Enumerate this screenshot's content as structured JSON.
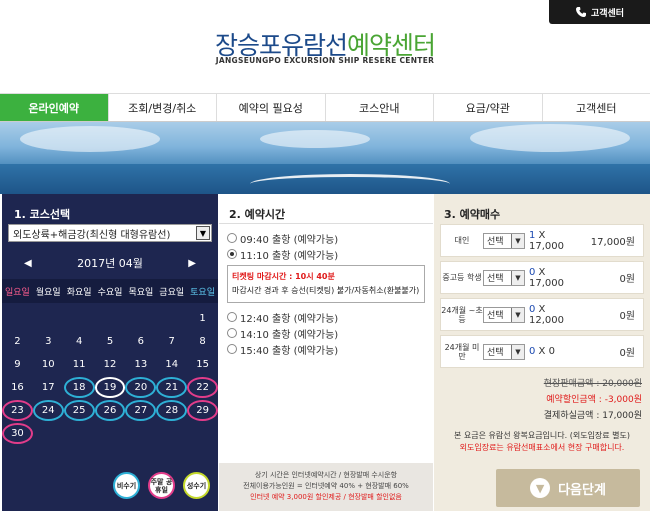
{
  "header": {
    "cs_label": "고객센터",
    "logo_main_blue": "장승포유람선",
    "logo_main_green": "예약센터",
    "logo_sub": "JANGSEUNGPO EXCURSION SHIP RESERE CENTER"
  },
  "nav": [
    {
      "label": "온라인예약",
      "active": true
    },
    {
      "label": "조회/변경/취소"
    },
    {
      "label": "예약의 필요성"
    },
    {
      "label": "코스안내"
    },
    {
      "label": "요금/약관"
    },
    {
      "label": "고객센터"
    }
  ],
  "course": {
    "title": "1. 코스선택",
    "selected": "외도상륙+해금강(최신형 대형유람선)",
    "month": "2017년 04월",
    "weekdays": [
      "일요일",
      "월요일",
      "화요일",
      "수요일",
      "목요일",
      "금요일",
      "토요일"
    ],
    "weeks": [
      [
        "",
        "",
        "",
        "",
        "",
        "",
        "1"
      ],
      [
        "2",
        "3",
        "4",
        "5",
        "6",
        "7",
        "8"
      ],
      [
        "9",
        "10",
        "11",
        "12",
        "13",
        "14",
        "15"
      ],
      [
        "16",
        "17",
        "18",
        "19",
        "20",
        "21",
        "22"
      ],
      [
        "23",
        "24",
        "25",
        "26",
        "27",
        "28",
        "29"
      ],
      [
        "30",
        "",
        "",
        "",
        "",
        "",
        ""
      ]
    ],
    "legend": [
      "비수기",
      "주말 공휴일",
      "성수기"
    ]
  },
  "times": {
    "title": "2. 예약시간",
    "options": [
      "09:40 출항 (예약가능)",
      "11:10 출항 (예약가능)",
      "12:40 출항 (예약가능)",
      "14:10 출항 (예약가능)",
      "15:40 출항 (예약가능)"
    ],
    "notice_label": "티켓팅 마감시간 : ",
    "notice_time": "10시 40분",
    "notice_text": "마감시간 경과 후 승선(티켓팅) 불가/자동취소(환불불가)",
    "foot_line1": "상기 시간은 인터넷예약시간 / 현장발매 수시운항",
    "foot_line2": "전체이용가능인원 = 인터넷예약 40% + 현장발매 60%",
    "foot_line3": "인터넷 예약 3,000원 할인제공 / 현장발매 할인없음"
  },
  "tickets": {
    "title": "3. 예약매수",
    "select_label": "선택",
    "rows": [
      {
        "label": "대인",
        "count": "1",
        "x": " X 17,000",
        "amount": "17,000원"
      },
      {
        "label": "중고등 학생",
        "count": "0",
        "x": " X 17,000",
        "amount": "0원"
      },
      {
        "label": "24개월 ~초등",
        "count": "0",
        "x": " X 12,000",
        "amount": "0원"
      },
      {
        "label": "24개월 미만",
        "count": "0",
        "x": " X 0",
        "amount": "0원"
      }
    ],
    "sum_sale": "현장판매금액 : 20,000원",
    "sum_discount": "예약할인금액 : -3,000원",
    "sum_pay": "결제하실금액 : 17,000원",
    "fee_line1": "본 요금은 유람선 왕복요금입니다. (외도입장료 별도)",
    "fee_line2": "외도입장료는 유람선매표소에서 현장 구매합니다.",
    "next_label": "다음단계"
  }
}
